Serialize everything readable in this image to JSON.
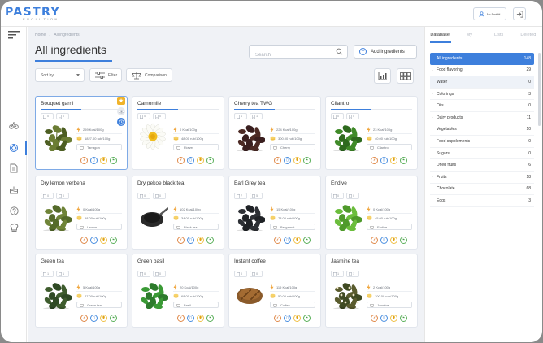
{
  "header": {
    "logo_title": "PASTRY",
    "logo_subtitle": "EVOLUTION",
    "user_label": "Mr.SmitH"
  },
  "breadcrumb": {
    "home": "Home",
    "separator": "/",
    "current": "All ingredients"
  },
  "page_title": "All ingredients",
  "search": {
    "placeholder": "Search"
  },
  "add_button_label": "Add ingredients",
  "toolbar": {
    "sort_label": "Sort by",
    "filter_label": "Filter",
    "comparison_label": "Comparison"
  },
  "cards": [
    {
      "name": "Bouquet garni",
      "c1": "0",
      "c2": "0",
      "kcal": "259 Kcal/100g",
      "price": "1827.00 rub/100g",
      "tag": "Tarragon",
      "photo": "herbs-bundle"
    },
    {
      "name": "Camomile",
      "c1": "0",
      "c2": "0",
      "kcal": "0 Kcal/100g",
      "price": "48.00 rub/100g",
      "tag": "Flower",
      "photo": "chamomile-flower"
    },
    {
      "name": "Cherry tea TWG",
      "c1": "1",
      "c2": "1",
      "kcal": "224 Kcal/100g",
      "price": "300.00 rub/100g",
      "tag": "Cherry",
      "photo": "dark-tea-leaves"
    },
    {
      "name": "Cilantro",
      "c1": "0",
      "c2": "0",
      "kcal": "23 Kcal/100g",
      "price": "40.00 rub/100g",
      "tag": "Cilantro",
      "photo": "cilantro-leaves"
    },
    {
      "name": "Dry lemon verbena",
      "c1": "0",
      "c2": "0",
      "kcal": "0 Kcal/100g",
      "price": "58.00 rub/100g",
      "tag": "Lemon",
      "photo": "dried-verbena"
    },
    {
      "name": "Dry pekoe black tea",
      "c1": "0",
      "c2": "0",
      "kcal": "102 Kcal/100g",
      "price": "34.00 rub/100g",
      "tag": "Black tea",
      "photo": "black-tea-spoon"
    },
    {
      "name": "Earl Grey tea",
      "c1": "7",
      "c2": "5",
      "kcal": "15 Kcal/100g",
      "price": "78.00 rub/100g",
      "tag": "Bergamot",
      "photo": "earl-grey-leaves"
    },
    {
      "name": "Endive",
      "c1": "0",
      "c2": "0",
      "kcal": "0 Kcal/100g",
      "price": "45.00 rub/100g",
      "tag": "Endive",
      "photo": "endive-leaves"
    },
    {
      "name": "Green tea",
      "c1": "1",
      "c2": "1",
      "kcal": "5 Kcal/100g",
      "price": "27.00 rub/100g",
      "tag": "Green tea",
      "photo": "green-tea-leaves"
    },
    {
      "name": "Green basil",
      "c1": "0",
      "c2": "0",
      "kcal": "20 Kcal/100g",
      "price": "68.00 rub/100g",
      "tag": "Basil",
      "photo": "basil-leaves"
    },
    {
      "name": "Instant coffee",
      "c1": "0",
      "c2": "0",
      "kcal": "119 Kcal/100g",
      "price": "50.00 rub/100g",
      "tag": "Coffee",
      "photo": "coffee-granules"
    },
    {
      "name": "Jasmine tea",
      "c1": "1",
      "c2": "1",
      "kcal": "2 Kcal/100g",
      "price": "100.00 rub/100g",
      "tag": "Jasmine",
      "photo": "jasmine-tea-leaves"
    }
  ],
  "right_panel": {
    "tabs": [
      "Database",
      "My",
      "Lists",
      "Deleted"
    ],
    "categories": [
      {
        "label": "All ingredients",
        "count": "148",
        "arrow": ""
      },
      {
        "label": "Food flavoring",
        "count": "29",
        "arrow": "›"
      },
      {
        "label": "Water",
        "count": "0",
        "arrow": ""
      },
      {
        "label": "Colorings",
        "count": "3",
        "arrow": "›"
      },
      {
        "label": "Oils",
        "count": "0",
        "arrow": ""
      },
      {
        "label": "Dairy products",
        "count": "11",
        "arrow": "›"
      },
      {
        "label": "Vegetables",
        "count": "10",
        "arrow": ""
      },
      {
        "label": "Food supplements",
        "count": "0",
        "arrow": ""
      },
      {
        "label": "Sugars",
        "count": "0",
        "arrow": ""
      },
      {
        "label": "Dried fruits",
        "count": "6",
        "arrow": ""
      },
      {
        "label": "Fruits",
        "count": "18",
        "arrow": "›"
      },
      {
        "label": "Chocolate",
        "count": "68",
        "arrow": ""
      },
      {
        "label": "Eggs",
        "count": "3",
        "arrow": ""
      }
    ]
  },
  "colors": {
    "accent": "#3d7fdc",
    "star": "#f0b32a",
    "background": "#f0f2f6"
  }
}
